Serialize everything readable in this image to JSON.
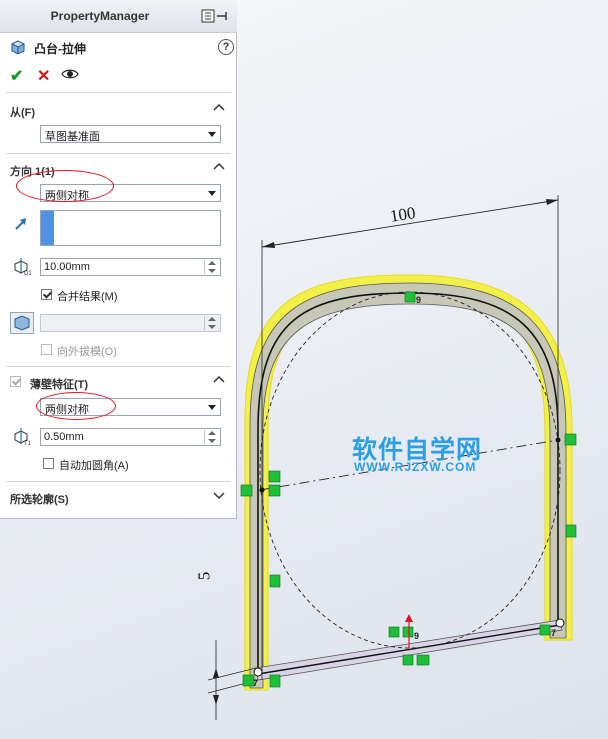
{
  "property_manager": {
    "title": "PropertyManager",
    "feature_title": "凸台-拉伸",
    "help_icon": "?",
    "ok_icon": "✔",
    "cancel_icon": "✕",
    "preview_icon": "eye-icon"
  },
  "from": {
    "label": "从(F)",
    "value": "草图基准面"
  },
  "direction1": {
    "label": "方向 1(1)",
    "end_condition": "两侧对称",
    "depth": "10.00mm",
    "merge_label": "合并结果(M)",
    "merge_checked": true,
    "draft_label": "向外拔模(O)",
    "draft_checked": false
  },
  "thin_feature": {
    "label": "薄壁特征(T)",
    "type": "两侧对称",
    "thickness": "0.50mm",
    "auto_fillet_label": "自动加圆角(A)",
    "auto_fillet_checked": false
  },
  "selected_contours": {
    "label": "所选轮廓(S)"
  },
  "graphics": {
    "dim_width": "100",
    "dim_height": "5",
    "tag_top": "9",
    "tag_bottom": "9",
    "tag_left": "7",
    "tag_right": "7",
    "accent_yellow": "#f3f04a",
    "relation_green": "#1fbf3a"
  },
  "watermark": {
    "title": "软件自学网",
    "url": "WWW.RJZXW.COM"
  }
}
